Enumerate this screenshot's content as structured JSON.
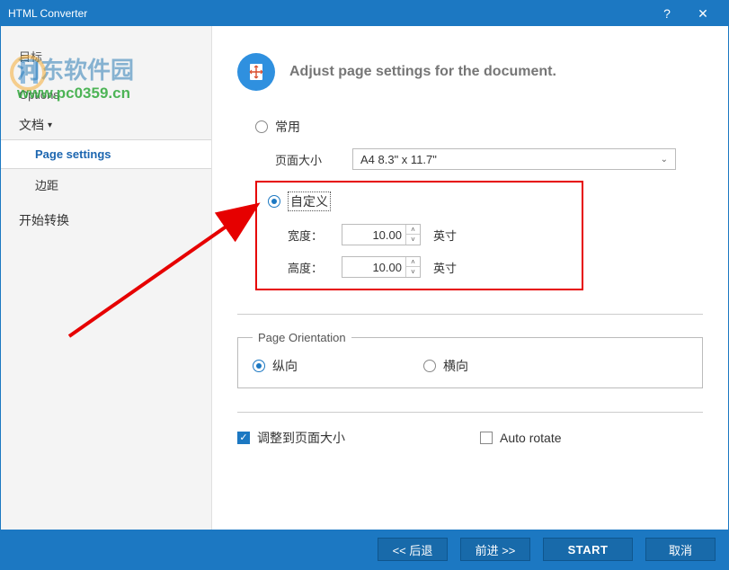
{
  "titlebar": {
    "title": "HTML Converter",
    "help": "?",
    "close": "✕"
  },
  "watermark": {
    "line1": "河东软件园",
    "line2": "www.pc0359.cn"
  },
  "sidebar": {
    "target": "目标",
    "options": "Options",
    "doc_section": "文档",
    "page_settings": "Page settings",
    "margins": "边距",
    "start_convert": "开始转换"
  },
  "main": {
    "heading": "Adjust page settings for the document.",
    "common_radio": "常用",
    "pagesize_label": "页面大小",
    "pagesize_value": "A4 8.3\" x 11.7\"",
    "custom_radio": "自定义",
    "width_label": "宽度：",
    "width_value": "10.00",
    "height_label": "高度：",
    "height_value": "10.00",
    "unit": "英寸",
    "orientation_legend": "Page Orientation",
    "portrait": "纵向",
    "landscape": "横向",
    "fit_to_page": "调整到页面大小",
    "auto_rotate": "Auto rotate"
  },
  "footer": {
    "back": "<<  后退",
    "next": "前进  >>",
    "start": "START",
    "cancel": "取消"
  }
}
